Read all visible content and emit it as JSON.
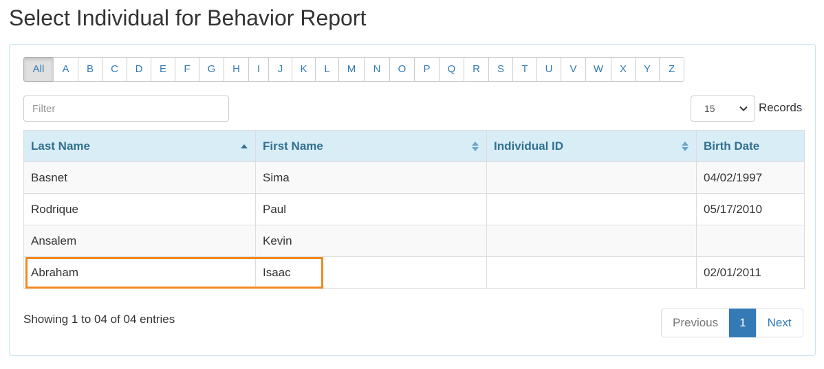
{
  "title": "Select Individual for Behavior Report",
  "alphabet": [
    "All",
    "A",
    "B",
    "C",
    "D",
    "E",
    "F",
    "G",
    "H",
    "I",
    "J",
    "K",
    "L",
    "M",
    "N",
    "O",
    "P",
    "Q",
    "R",
    "S",
    "T",
    "U",
    "V",
    "W",
    "X",
    "Y",
    "Z"
  ],
  "alphabet_active": "All",
  "filter": {
    "placeholder": "Filter",
    "value": ""
  },
  "records": {
    "selected": "15",
    "label": "Records"
  },
  "table": {
    "columns": [
      "Last Name",
      "First Name",
      "Individual ID",
      "Birth Date"
    ],
    "sort": {
      "column": "Last Name",
      "direction": "ascending"
    },
    "rows": [
      {
        "last": "Basnet",
        "first": "Sima",
        "id": "",
        "birth": "04/02/1997"
      },
      {
        "last": "Rodrique",
        "first": "Paul",
        "id": "",
        "birth": "05/17/2010"
      },
      {
        "last": "Ansalem",
        "first": "Kevin",
        "id": "",
        "birth": ""
      },
      {
        "last": "Abraham",
        "first": "Isaac",
        "id": "",
        "birth": "02/01/2011"
      }
    ]
  },
  "info": "Showing 1 to 04 of 04 entries",
  "pagination": {
    "previous": "Previous",
    "current": "1",
    "next": "Next"
  },
  "colors": {
    "header_bg": "#d9edf7",
    "header_text": "#31708f",
    "link": "#337ab7",
    "highlight": "#f0891f"
  }
}
